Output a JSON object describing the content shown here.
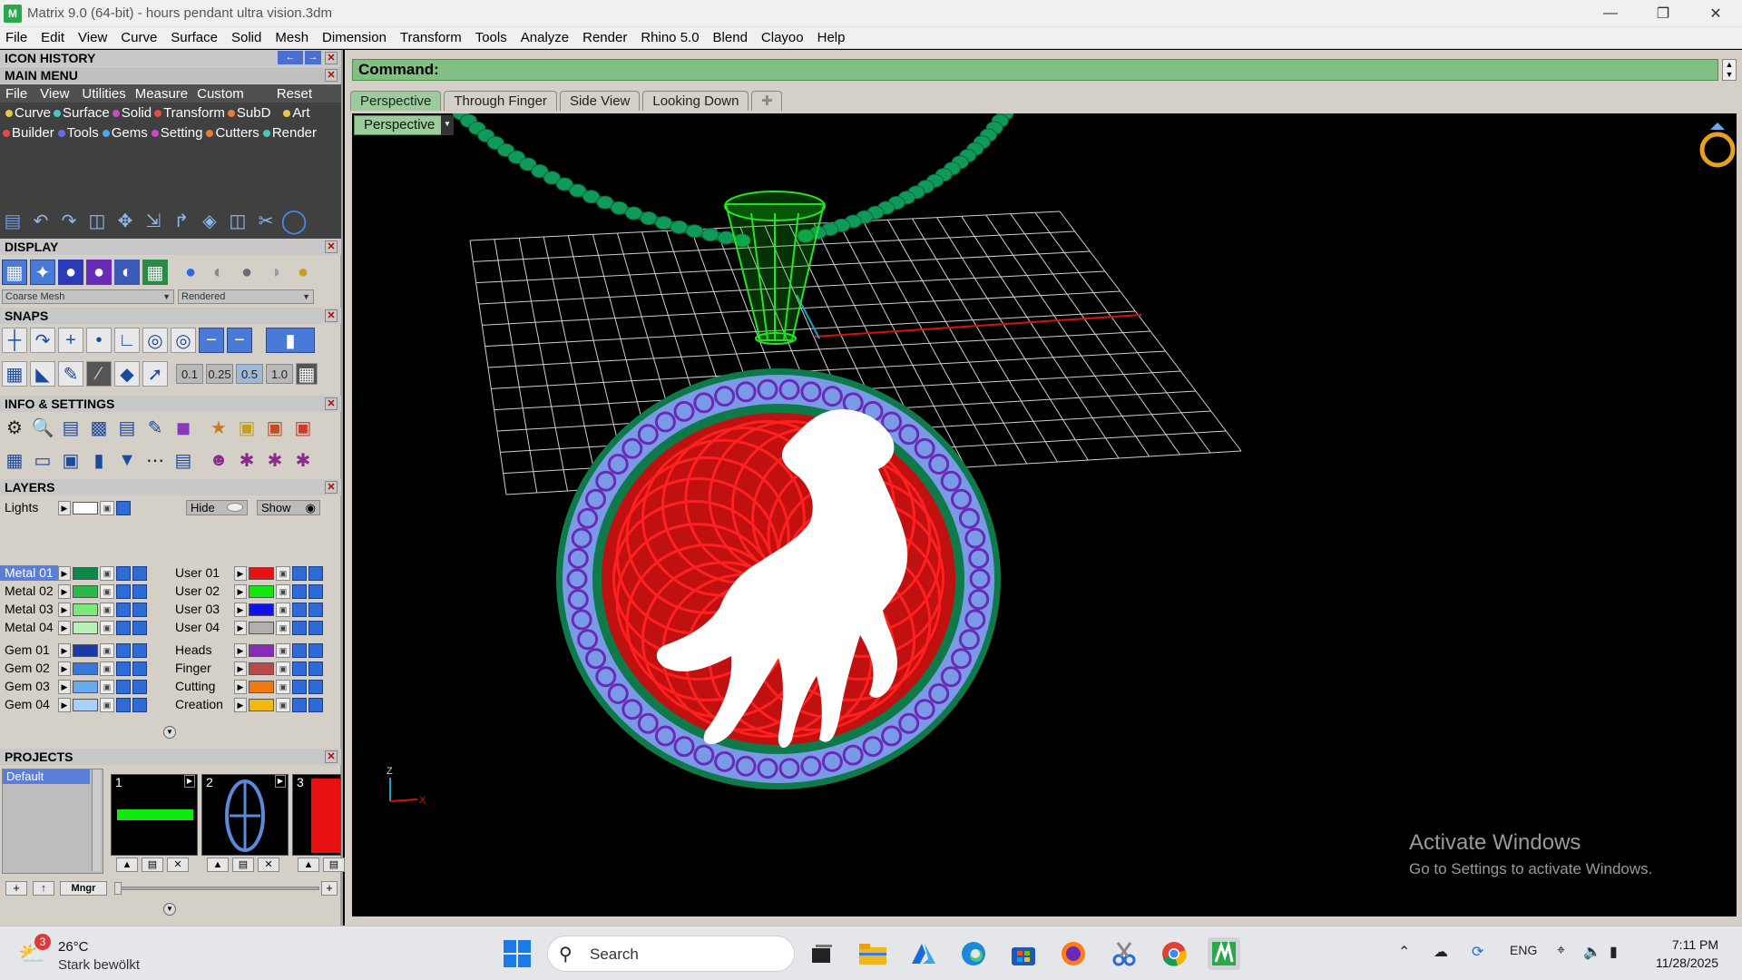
{
  "window": {
    "title": "Matrix 9.0 (64-bit) - hours pendant ultra vision.3dm",
    "app_icon": "matrix-icon",
    "controls": [
      "minimize",
      "restore",
      "close"
    ]
  },
  "menubar": [
    "File",
    "Edit",
    "View",
    "Curve",
    "Surface",
    "Solid",
    "Mesh",
    "Dimension",
    "Transform",
    "Tools",
    "Analyze",
    "Render",
    "Rhino 5.0",
    "Blend",
    "Clayoo",
    "Help"
  ],
  "left_panel": {
    "icon_history": "ICON HISTORY",
    "main_menu": {
      "title": "MAIN MENU",
      "row1": [
        "File",
        "View",
        "Utilities",
        "Measure",
        "Custom",
        "Reset"
      ],
      "row2": [
        {
          "label": "Curve",
          "color": "#e8c84a"
        },
        {
          "label": "Surface",
          "color": "#4ac8c0"
        },
        {
          "label": "Solid",
          "color": "#c84ac8"
        },
        {
          "label": "Transform",
          "color": "#e84a4a"
        },
        {
          "label": "SubD",
          "color": "#e87a3a"
        },
        {
          "label": "Art",
          "color": "#e8c84a"
        }
      ],
      "row3": [
        {
          "label": "Builder",
          "color": "#e84a4a"
        },
        {
          "label": "Tools",
          "color": "#6a6ae8"
        },
        {
          "label": "Gems",
          "color": "#4aa8e8"
        },
        {
          "label": "Setting",
          "color": "#c84ac8"
        },
        {
          "label": "Cutters",
          "color": "#e87a3a"
        },
        {
          "label": "Render",
          "color": "#4ac8c0"
        }
      ]
    },
    "display": {
      "title": "DISPLAY",
      "mesh_select": "Coarse Mesh",
      "render_select": "Rendered"
    },
    "snaps": {
      "title": "SNAPS",
      "values": [
        "0.1",
        "0.25",
        "0.5",
        "1.0"
      ]
    },
    "info_settings": {
      "title": "INFO & SETTINGS"
    },
    "layers": {
      "title": "LAYERS",
      "lights": "Lights",
      "hide": "Hide",
      "show": "Show",
      "left": [
        {
          "name": "Metal 01",
          "color": "#0a8a4a"
        },
        {
          "name": "Metal 02",
          "color": "#2ab84a"
        },
        {
          "name": "Metal 03",
          "color": "#7ae87a"
        },
        {
          "name": "Metal 04",
          "color": "#b8f0b8"
        },
        {
          "name": "Gem 01",
          "color": "#1a3aa8"
        },
        {
          "name": "Gem 02",
          "color": "#3a78d8"
        },
        {
          "name": "Gem 03",
          "color": "#6aa8f0"
        },
        {
          "name": "Gem 04",
          "color": "#a8d0f8"
        }
      ],
      "right": [
        {
          "name": "User 01",
          "color": "#e81010"
        },
        {
          "name": "User 02",
          "color": "#10e810"
        },
        {
          "name": "User 03",
          "color": "#1010e8"
        },
        {
          "name": "User 04",
          "color": "#b0b0b0"
        },
        {
          "name": "Heads",
          "color": "#8a2ab8"
        },
        {
          "name": "Finger",
          "color": "#b84a4a"
        },
        {
          "name": "Cutting",
          "color": "#f07a10"
        },
        {
          "name": "Creation",
          "color": "#f0b810"
        }
      ]
    },
    "projects": {
      "title": "PROJECTS",
      "default": "Default",
      "thumbs": [
        "1",
        "2",
        "3"
      ],
      "mngr": "Mngr"
    }
  },
  "main": {
    "command_label": "Command:",
    "tabs": [
      "Perspective",
      "Through Finger",
      "Side View",
      "Looking Down"
    ],
    "viewport_label": "Perspective",
    "axis_z": "Z",
    "axis_x": "X"
  },
  "watermark": {
    "line1": "Activate Windows",
    "line2": "Go to Settings to activate Windows."
  },
  "taskbar": {
    "weather_badge": "3",
    "temp": "26°C",
    "condition": "Stark bewölkt",
    "search": "Search",
    "lang": "ENG",
    "time": "7:11 PM",
    "date": "11/28/2025"
  }
}
